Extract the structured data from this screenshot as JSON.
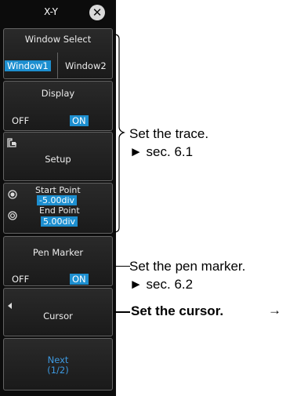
{
  "header": {
    "title": "X-Y"
  },
  "menu": {
    "window_select": {
      "label": "Window Select",
      "options": [
        "Window1",
        "Window2"
      ],
      "selected": "Window1"
    },
    "display": {
      "label": "Display",
      "off": "OFF",
      "on": "ON",
      "selected": "ON"
    },
    "setup": {
      "label": "Setup"
    },
    "start_point": {
      "label": "Start Point",
      "value": "-5.00div"
    },
    "end_point": {
      "label": "End Point",
      "value": "5.00div"
    },
    "pen_marker": {
      "label": "Pen Marker",
      "off": "OFF",
      "on": "ON",
      "selected": "ON"
    },
    "cursor": {
      "label": "Cursor"
    },
    "next": {
      "label": "Next",
      "page": "(1/2)"
    }
  },
  "annotations": {
    "trace": {
      "text": "Set the trace.",
      "ref": "► sec. 6.1"
    },
    "pen": {
      "text": "Set the pen marker.",
      "ref": "► sec. 6.2"
    },
    "cursor": {
      "text": "Set the cursor.",
      "arrow": "→"
    }
  },
  "colors": {
    "selected": "#1d8fd0",
    "panel_bg": "#0c0c0c",
    "border": "#646464"
  }
}
